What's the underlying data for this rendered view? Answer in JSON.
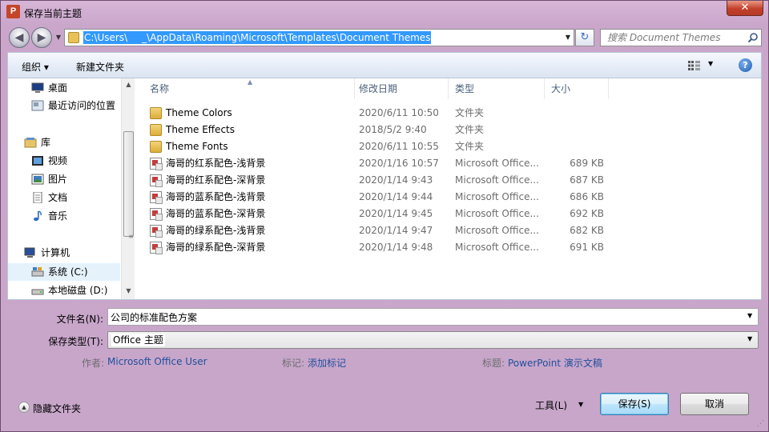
{
  "window": {
    "title": "保存当前主题",
    "app_icon": "P",
    "close": "✕"
  },
  "address": {
    "path": "C:\\Users\\         _\\AppData\\Roaming\\Microsoft\\Templates\\Document Themes"
  },
  "search": {
    "placeholder": "搜索 Document Themes"
  },
  "toolbar": {
    "organize": "组织 ▾",
    "new_folder": "新建文件夹",
    "help": "?"
  },
  "nav_tree": [
    {
      "label": "桌面",
      "icon": "desktop-icon"
    },
    {
      "label": "最近访问的位置",
      "icon": "recent-places-icon"
    },
    {
      "label": "库",
      "icon": "library-icon"
    },
    {
      "label": "视频",
      "icon": "video-icon"
    },
    {
      "label": "图片",
      "icon": "pictures-icon"
    },
    {
      "label": "文档",
      "icon": "documents-icon"
    },
    {
      "label": "音乐",
      "icon": "music-icon"
    },
    {
      "label": "计算机",
      "icon": "computer-icon"
    },
    {
      "label": "系统 (C:)",
      "icon": "drive-c-icon"
    },
    {
      "label": "本地磁盘 (D:)",
      "icon": "drive-d-icon"
    }
  ],
  "columns": {
    "name": "名称",
    "date": "修改日期",
    "type": "类型",
    "size": "大小"
  },
  "files": [
    {
      "name": "Theme Colors",
      "date": "2020/6/11 10:50",
      "type": "文件夹",
      "size": "",
      "icon": "folder-icon"
    },
    {
      "name": "Theme Effects",
      "date": "2018/5/2 9:40",
      "type": "文件夹",
      "size": "",
      "icon": "folder-icon"
    },
    {
      "name": "Theme Fonts",
      "date": "2020/6/11 10:55",
      "type": "文件夹",
      "size": "",
      "icon": "folder-icon"
    },
    {
      "name": "海哥的红系配色-浅背景",
      "date": "2020/1/16 10:57",
      "type": "Microsoft Office...",
      "size": "689 KB",
      "icon": "theme-file-icon"
    },
    {
      "name": "海哥的红系配色-深背景",
      "date": "2020/1/14 9:43",
      "type": "Microsoft Office...",
      "size": "687 KB",
      "icon": "theme-file-icon"
    },
    {
      "name": "海哥的蓝系配色-浅背景",
      "date": "2020/1/14 9:44",
      "type": "Microsoft Office...",
      "size": "686 KB",
      "icon": "theme-file-icon"
    },
    {
      "name": "海哥的蓝系配色-深背景",
      "date": "2020/1/14 9:45",
      "type": "Microsoft Office...",
      "size": "692 KB",
      "icon": "theme-file-icon"
    },
    {
      "name": "海哥的绿系配色-浅背景",
      "date": "2020/1/14 9:47",
      "type": "Microsoft Office...",
      "size": "682 KB",
      "icon": "theme-file-icon"
    },
    {
      "name": "海哥的绿系配色-深背景",
      "date": "2020/1/14 9:48",
      "type": "Microsoft Office...",
      "size": "691 KB",
      "icon": "theme-file-icon"
    }
  ],
  "form": {
    "filename_label": "文件名(N):",
    "filename_value": "公司的标准配色方案",
    "filetype_label": "保存类型(T):",
    "filetype_value": "Office 主题",
    "author_label": "作者:",
    "author_value": "Microsoft Office User",
    "tags_label": "标记:",
    "tags_value": "添加标记",
    "title_label": "标题:",
    "title_value": "PowerPoint 演示文稿"
  },
  "bottom": {
    "hide_folders": "隐藏文件夹",
    "tools": "工具(L)",
    "save": "保存(S)",
    "cancel": "取消"
  },
  "colors": {
    "selection": "#3399ff",
    "link": "#1f4f9a",
    "frame": "#c8a6ca"
  }
}
